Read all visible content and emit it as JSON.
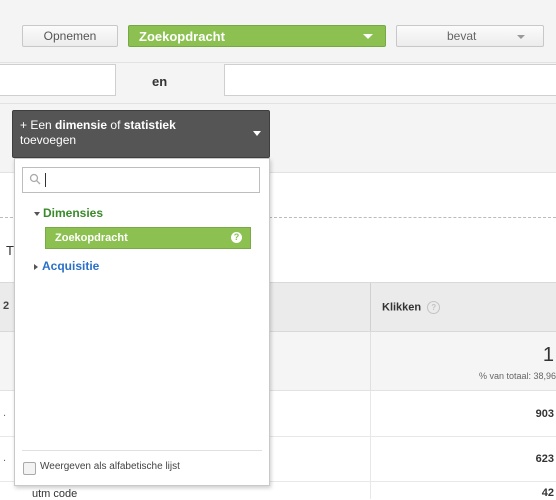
{
  "filter": {
    "mode_button": "Opnemen",
    "dimension_select": "Zoekopdracht",
    "operator_select": "bevat",
    "conjunction": "en"
  },
  "dropdown": {
    "button_prefix": "+ Een ",
    "button_strong1": "dimensie",
    "button_mid": " of ",
    "button_strong2": "statistiek",
    "button_line2": "toevoegen",
    "search_placeholder": "",
    "group_dimensions": "Dimensies",
    "selected_item": "Zoekopdracht",
    "help_glyph": "?",
    "group_acquisition": "Acquisitie",
    "checkbox_label": "Weergeven als alfabetische lijst"
  },
  "table": {
    "partial_left_letter": "T",
    "partial_header_num": "2",
    "column_header": "Klikken",
    "total_value": "1",
    "total_pct": "% van totaal: 38,96",
    "rows": [
      {
        "value": "903"
      },
      {
        "value": "623"
      },
      {
        "value": "42"
      }
    ],
    "utm_label": "utm code"
  },
  "icons": {
    "search": "magnifier-icon",
    "help": "question-icon"
  },
  "colors": {
    "accent_green": "#8cc151",
    "link_blue": "#2a6fc9",
    "dark_button": "#555555"
  }
}
